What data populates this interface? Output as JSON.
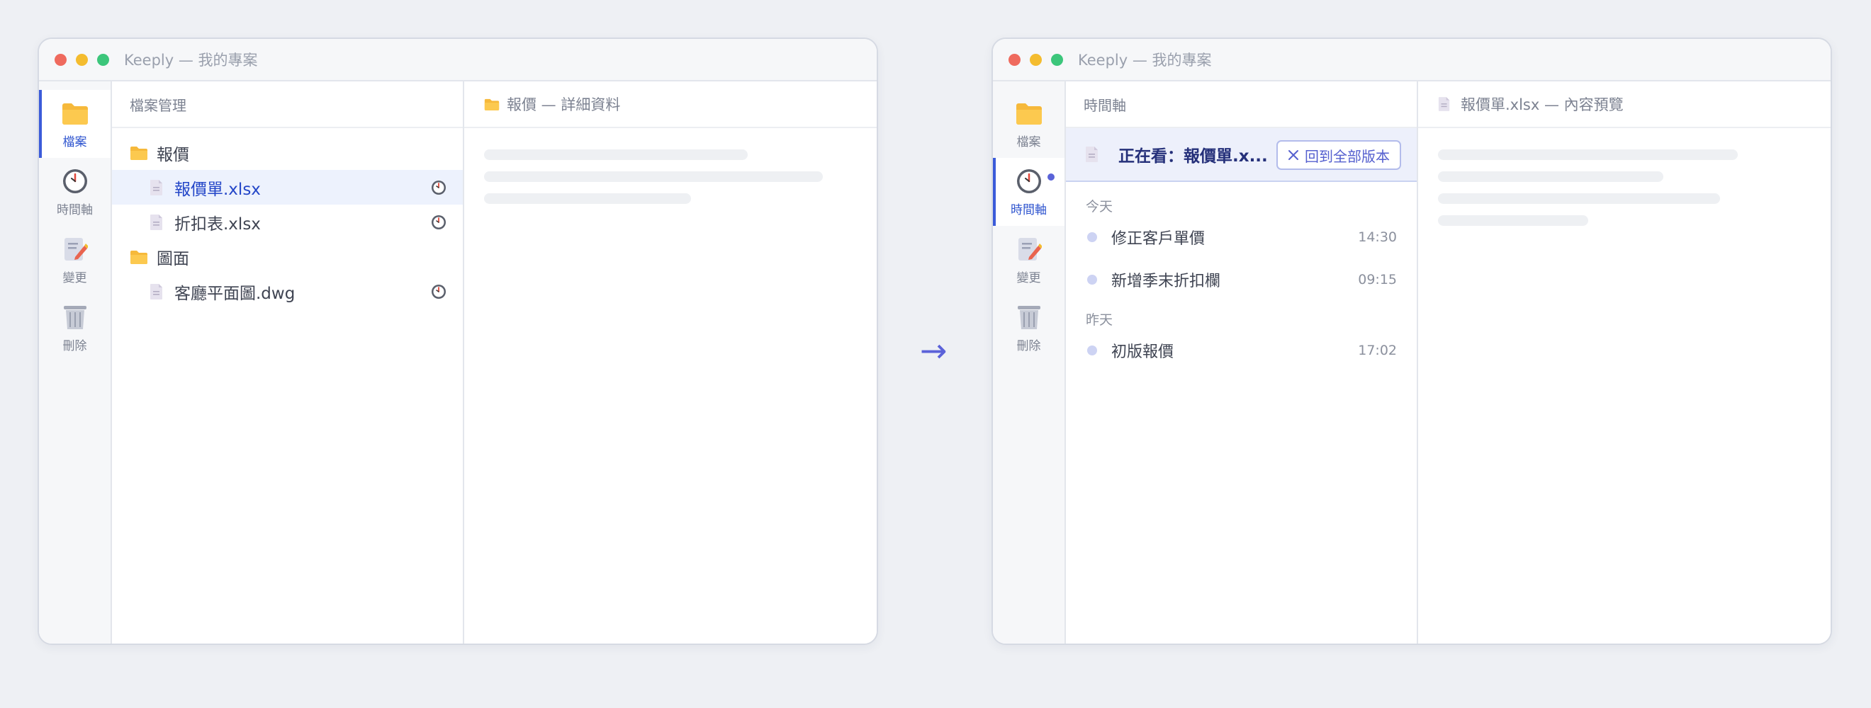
{
  "left_window": {
    "title": "Keeply — 我的專案",
    "rail": [
      {
        "label": "檔案",
        "icon": "folder-icon",
        "active": true
      },
      {
        "label": "時間軸",
        "icon": "clock-icon",
        "active": false
      },
      {
        "label": "變更",
        "icon": "edit-icon",
        "active": false
      },
      {
        "label": "刪除",
        "icon": "trash-icon",
        "active": false
      }
    ],
    "panel_title": "檔案管理",
    "tree": [
      {
        "type": "folder",
        "label": "報價"
      },
      {
        "type": "file",
        "label": "報價單.xlsx",
        "selected": true
      },
      {
        "type": "file",
        "label": "折扣表.xlsx"
      },
      {
        "type": "folder",
        "label": "圖面"
      },
      {
        "type": "file",
        "label": "客廳平面圖.dwg"
      }
    ],
    "detail_title": "報價 — 詳細資料"
  },
  "arrow": "→",
  "right_window": {
    "title": "Keeply — 我的專案",
    "rail": [
      {
        "label": "檔案",
        "icon": "folder-icon",
        "active": false
      },
      {
        "label": "時間軸",
        "icon": "clock-icon",
        "active": true
      },
      {
        "label": "變更",
        "icon": "edit-icon",
        "active": false
      },
      {
        "label": "刪除",
        "icon": "trash-icon",
        "active": false
      }
    ],
    "panel_title": "時間軸",
    "filter_text": "正在看：報價單.x...",
    "reset_label": "回到全部版本",
    "groups": [
      {
        "label": "今天",
        "items": [
          {
            "text": "修正客戶單價",
            "time": "14:30"
          },
          {
            "text": "新增季末折扣欄",
            "time": "09:15"
          }
        ]
      },
      {
        "label": "昨天",
        "items": [
          {
            "text": "初版報價",
            "time": "17:02"
          }
        ]
      }
    ],
    "detail_title": "報價單.xlsx — 內容預覽"
  },
  "colors": {
    "accent": "#3b5bd9",
    "selected_bg": "#edf2fd",
    "filter_bg": "#edf0fb",
    "badge": "#5a63d8"
  }
}
